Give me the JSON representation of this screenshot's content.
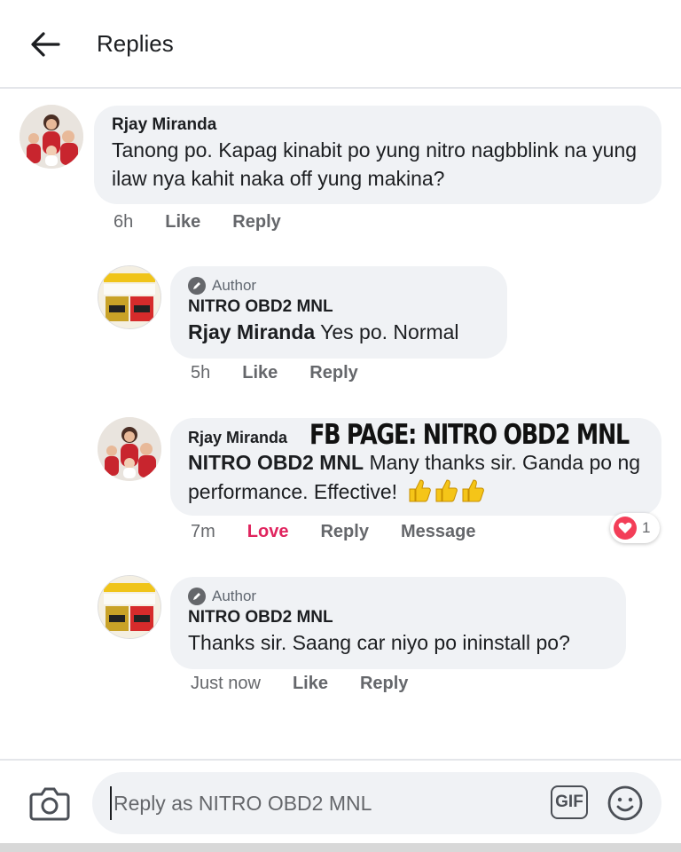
{
  "header": {
    "title": "Replies",
    "back_icon": "arrow-left-icon"
  },
  "comments": [
    {
      "name": "Rjay Miranda",
      "text": "Tanong po. Kapag kinabit po yung nitro nagbblink na yung ilaw nya kahit naka off yung makina?",
      "time": "6h",
      "like": "Like",
      "reply": "Reply"
    },
    {
      "author_badge": "Author",
      "name": "NITRO OBD2 MNL",
      "tag": "Rjay Miranda",
      "text": "Yes po. Normal",
      "time": "5h",
      "like": "Like",
      "reply": "Reply"
    },
    {
      "name": "Rjay Miranda",
      "tag": "NITRO OBD2 MNL",
      "text": "Many thanks sir. Ganda po ng performance. Effective!",
      "time": "7m",
      "love": "Love",
      "reply": "Reply",
      "message": "Message",
      "reaction_count": "1"
    },
    {
      "author_badge": "Author",
      "name": "NITRO OBD2 MNL",
      "text": "Thanks sir. Saang car niyo po ininstall po?",
      "time": "Just now",
      "like": "Like",
      "reply": "Reply"
    }
  ],
  "overlay_text": "FB PAGE: NITRO OBD2 MNL",
  "composer": {
    "placeholder": "Reply as NITRO OBD2 MNL",
    "gif_label": "GIF",
    "camera_icon": "camera-icon",
    "emoji_icon": "smiley-icon"
  },
  "colors": {
    "bubble": "#f0f2f5",
    "love": "#e0245e",
    "heart": "#f33e58"
  }
}
